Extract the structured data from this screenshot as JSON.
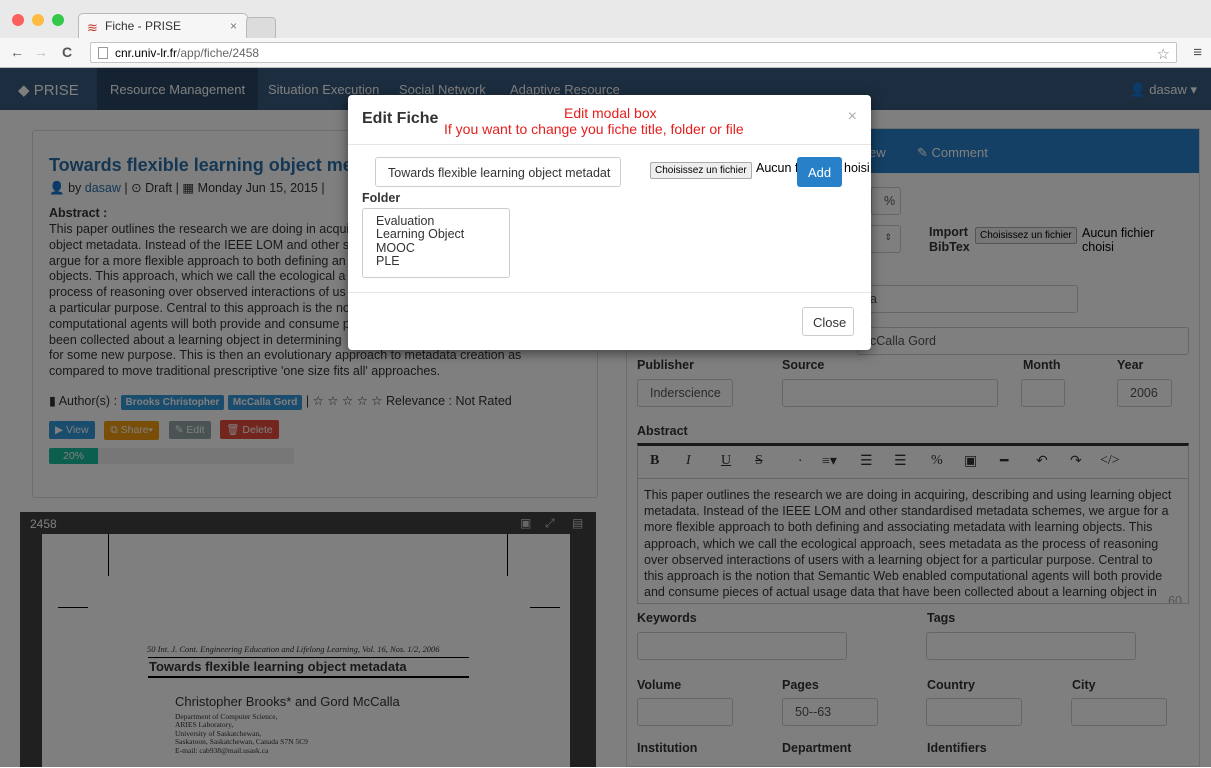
{
  "browser": {
    "tab_title": "Fiche - PRISE",
    "tab_close": "×",
    "url_host": "cnr.univ-lr.fr",
    "url_path": "/app/fiche/2458"
  },
  "appnav": {
    "brand": "PRISE",
    "items": [
      "Resource Management",
      "Situation Execution",
      "Social Network",
      "Adaptive Resource"
    ],
    "user": "dasaw"
  },
  "fiche": {
    "title": "Towards flexible learning object metadata",
    "by": "by",
    "author_link": "dasaw",
    "status": "Draft",
    "date": "Monday Jun 15, 2015",
    "abstract_label": "Abstract :",
    "abstract_lines": [
      "This paper outlines the research we are doing in acqui",
      "object metadata. Instead of the IEEE LOM and other s",
      "argue for a more flexible approach to both defining an",
      "objects. This approach, which we call the ecological a",
      "process of reasoning over observed interactions of us",
      "a particular purpose. Central to this approach is the no",
      "computational agents will both provide and consume p",
      "been collected about a learning object in determining",
      "for some new purpose. This is then an evolutionary approach to metadata creation as",
      "compared to move traditional prescriptive 'one size fits all' approaches."
    ],
    "authors_label": "Author(s) :",
    "authors": [
      "Brooks Christopher",
      "McCalla Gord"
    ],
    "relevance": "Relevance : Not Rated",
    "buttons": {
      "view": "View",
      "share": "Share",
      "edit": "Edit",
      "delete": "Delete"
    },
    "progress": 0.2,
    "progress_label": "20%"
  },
  "viewer": {
    "doc_id": "2458",
    "journal_line": "50    Int. J. Cont. Engineering Education and Lifelong Learning, Vol. 16, Nos. 1/2, 2006",
    "paper_title": "Towards flexible learning object metadata",
    "paper_authors": "Christopher Brooks* and Gord McCalla",
    "affiliation": [
      "Department of Computer Science,",
      "ARIES Laboratory,",
      "University of Saskatchewan,",
      "Saskatoon, Saskatchewan, Canada S7N 5C9",
      "E-mail: cab938@mail.usask.ca"
    ]
  },
  "rightpanel": {
    "tabs": [
      "ew",
      "Comment"
    ],
    "percent": "%",
    "import_label_1": "Import",
    "import_label_2": "BibTex",
    "file_button": "Choisissez un fichier",
    "file_text": "Aucun fichier choisi",
    "title_fragment": "a",
    "authors_fragment": "cCalla Gord",
    "labels": {
      "publisher": "Publisher",
      "source": "Source",
      "month": "Month",
      "year": "Year",
      "abstract": "Abstract",
      "keywords": "Keywords",
      "tags": "Tags",
      "volume": "Volume",
      "pages": "Pages",
      "country": "Country",
      "city": "City",
      "institution": "Institution",
      "department": "Department",
      "identifiers": "Identifiers"
    },
    "values": {
      "publisher": "Inderscience",
      "year": "2006",
      "pages": "50--63"
    },
    "editor_lines": [
      "This paper outlines the research we are doing in acquiring, describing and using learning object",
      "metadata. Instead of the IEEE LOM and other standardised metadata schemes, we argue for a",
      "more flexible approach to both defining and associating metadata with learning objects. This",
      "approach, which we call the ecological approach, sees metadata as the process of reasoning",
      "over observed interactions of users with a learning object for a particular purpose. Central to",
      "this approach is the notion that Semantic Web enabled computational agents will both provide",
      "and consume pieces of actual usage data that have been collected about a learning object in"
    ],
    "editor_count": "60"
  },
  "modal": {
    "title": "Edit Fiche",
    "annotation_1": "Edit modal box",
    "annotation_2": "If you want to change you fiche title, folder or file",
    "close_x": "×",
    "title_value": "Towards flexible learning object metadat",
    "file_button": "Choisissez un fichier",
    "file_text_a": "Aucun f",
    "file_text_b": "hoisi",
    "add": "Add",
    "folder_label": "Folder",
    "folders": [
      "Evaluation",
      "Learning Object",
      "MOOC",
      "PLE"
    ],
    "close": "Close"
  }
}
